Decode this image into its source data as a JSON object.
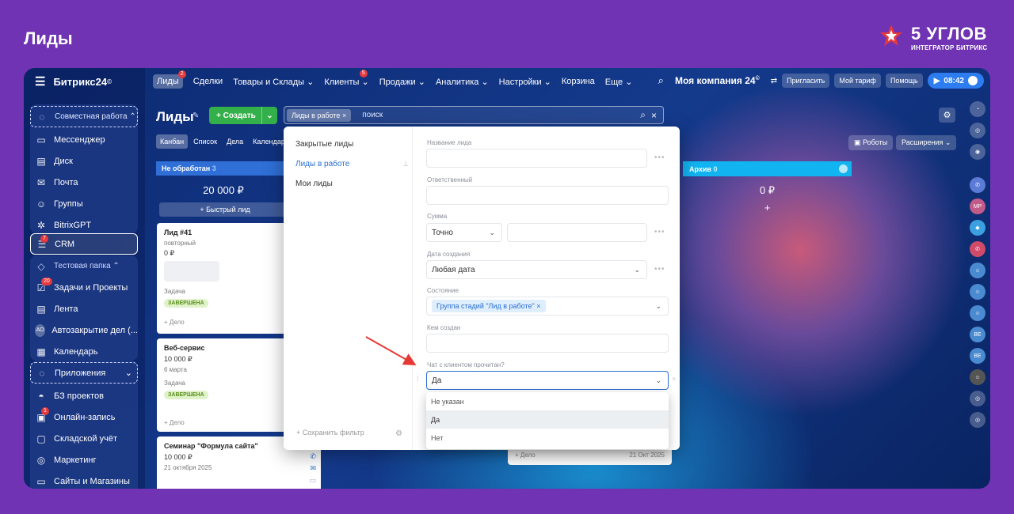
{
  "slide_title": "Лиды",
  "logo": {
    "name": "5 УГЛОВ",
    "tagline": "ИНТЕГРАТОР БИТРИКС"
  },
  "app": {
    "brand": "Битрикс24",
    "brand_sup": "©"
  },
  "topnav": {
    "items": [
      {
        "label": "Лиды",
        "badge": "2"
      },
      {
        "label": "Сделки"
      },
      {
        "label": "Товары и Склады ⌄"
      },
      {
        "label": "Клиенты ⌄",
        "badge": "5"
      },
      {
        "label": "Продажи ⌄"
      },
      {
        "label": "Аналитика ⌄"
      },
      {
        "label": "Настройки ⌄"
      },
      {
        "label": "Корзина"
      },
      {
        "label": "Еще ⌄"
      }
    ],
    "company": "Моя компания 24",
    "company_sup": "©",
    "invite": "Пригласить",
    "tariff": "Мой тариф",
    "help": "Помощь",
    "clock": "08:42"
  },
  "sidebar": {
    "collab": "Совместная работа ⌃",
    "items1": [
      {
        "label": "Мессенджер",
        "icon": "chat-icon"
      },
      {
        "label": "Диск",
        "icon": "disk-icon"
      },
      {
        "label": "Почта",
        "icon": "mail-icon"
      },
      {
        "label": "Группы",
        "icon": "groups-icon"
      },
      {
        "label": "BitrixGPT",
        "icon": "gpt-icon"
      }
    ],
    "crm": {
      "label": "CRM",
      "badge": "7"
    },
    "test_folder": "Тестовая папка ⌃",
    "items2": [
      {
        "label": "Задачи и Проекты",
        "badge": "20"
      },
      {
        "label": "Лента"
      },
      {
        "label": "Автозакрытие дел (...",
        "avatar": "АО"
      },
      {
        "label": "Календарь"
      }
    ],
    "apps": "Приложения",
    "items3": [
      {
        "label": "БЗ проектов"
      },
      {
        "label": "Онлайн-запись",
        "badge": "1"
      },
      {
        "label": "Складской учёт"
      },
      {
        "label": "Маркетинг"
      },
      {
        "label": "Сайты и Магазины"
      }
    ]
  },
  "toolbar": {
    "title": "Лиды",
    "create": "+ Создать",
    "filter_chip": "Лиды в работе",
    "search_placeholder": "поиск",
    "tabs": [
      "Канбан",
      "Список",
      "Дела",
      "Календарь"
    ],
    "robots": "Роботы",
    "extensions": "Расширения"
  },
  "kanban": {
    "col1": {
      "title": "Не обработан",
      "count": "3",
      "sum": "20 000 ₽",
      "quick": "+ Быстрый лид"
    },
    "cards": [
      {
        "title": "Лид #41",
        "sub": "повторный",
        "price": "0 ₽",
        "task": "Задача",
        "status": "ЗАВЕРШЕНА",
        "add": "+ Дело"
      },
      {
        "title": "Веб-сервис",
        "price": "10 000 ₽",
        "date": "6 марта",
        "task": "Задача",
        "status": "ЗАВЕРШЕНА",
        "add": "+ Дело"
      },
      {
        "title": "Семинар \"Формула сайта\"",
        "price": "10 000 ₽",
        "date": "21 октября 2025"
      }
    ],
    "col3_card": {
      "add": "+ Дело",
      "date": "21 Окт 2025"
    },
    "archive": {
      "title": "Архив",
      "count": "0",
      "sum": "0 ₽",
      "plus": "+"
    }
  },
  "filter": {
    "presets": [
      "Закрытые лиды",
      "Лиды в работе",
      "Мои лиды"
    ],
    "save": "+ Сохранить фильтр",
    "fields": {
      "name": "Название лида",
      "resp": "Ответственный",
      "sum": "Сумма",
      "sum_mode": "Точно",
      "created": "Дата создания",
      "created_val": "Любая дата",
      "state": "Состояние",
      "state_chip": "Группа стадий \"Лид в работе\"",
      "author": "Кем создан",
      "chat": "Чат с клиентом прочитан?",
      "chat_val": "Да"
    },
    "options": [
      "Не указан",
      "Да",
      "Нет"
    ]
  },
  "colors": {
    "bg": "#6f33b3",
    "accent": "#2b6fd0",
    "green": "#34b04a",
    "archive": "#11b4f0"
  }
}
